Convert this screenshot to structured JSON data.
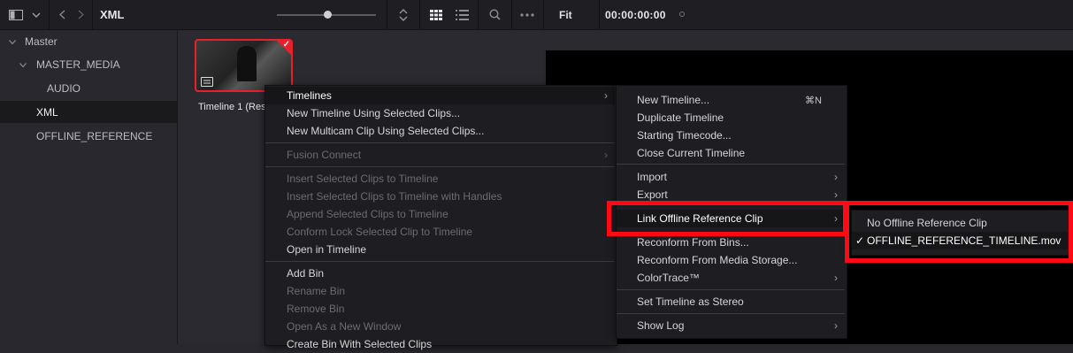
{
  "toolbar": {
    "path_title": "XML",
    "fit_label": "Fit",
    "timecode": "00:00:00:00"
  },
  "sidebar": {
    "items": [
      {
        "label": "Master",
        "expanded": true
      },
      {
        "label": "MASTER_MEDIA",
        "expanded": true
      },
      {
        "label": "AUDIO"
      },
      {
        "label": "XML",
        "selected": true
      },
      {
        "label": "OFFLINE_REFERENCE"
      }
    ]
  },
  "pool": {
    "clip_name": "Timeline 1 (Res"
  },
  "context_menu": {
    "items": [
      {
        "label": "Timelines",
        "state": "highlighted",
        "submenu": true
      },
      {
        "label": "New Timeline Using Selected Clips...",
        "state": "enabled"
      },
      {
        "label": "New Multicam Clip Using Selected Clips...",
        "state": "enabled"
      },
      {
        "label": "Fusion Connect",
        "state": "disabled",
        "submenu": true
      },
      {
        "label": "Insert Selected Clips to Timeline",
        "state": "disabled"
      },
      {
        "label": "Insert Selected Clips to Timeline with Handles",
        "state": "disabled"
      },
      {
        "label": "Append Selected Clips to Timeline",
        "state": "disabled"
      },
      {
        "label": "Conform Lock Selected Clip to Timeline",
        "state": "disabled"
      },
      {
        "label": "Open in Timeline",
        "state": "enabled"
      },
      {
        "label": "Add Bin",
        "state": "enabled"
      },
      {
        "label": "Rename Bin",
        "state": "disabled"
      },
      {
        "label": "Remove Bin",
        "state": "disabled"
      },
      {
        "label": "Open As a New Window",
        "state": "disabled"
      },
      {
        "label": "Create Bin With Selected Clips",
        "state": "enabled"
      }
    ]
  },
  "timelines_submenu": {
    "items": [
      {
        "label": "New Timeline...",
        "shortcut": "⌘N"
      },
      {
        "label": "Duplicate Timeline"
      },
      {
        "label": "Starting Timecode..."
      },
      {
        "label": "Close Current Timeline"
      },
      {
        "label": "Import",
        "submenu": true
      },
      {
        "label": "Export",
        "submenu": true
      },
      {
        "label": "Link Offline Reference Clip",
        "submenu": true,
        "state": "highlighted"
      },
      {
        "label": "Reconform From Bins..."
      },
      {
        "label": "Reconform From Media Storage..."
      },
      {
        "label": "ColorTrace™",
        "submenu": true
      },
      {
        "label": "Set Timeline as Stereo"
      },
      {
        "label": "Show Log",
        "submenu": true
      }
    ]
  },
  "offline_submenu": {
    "items": [
      {
        "label": "No Offline Reference Clip",
        "checked": false
      },
      {
        "label": "OFFLINE_REFERENCE_TIMELINE.mov",
        "checked": true,
        "check_glyph": "✓"
      }
    ]
  },
  "colors": {
    "annotation_red": "#ff0a14",
    "selection_red": "#e8202a",
    "menu_bg": "#1e1e22"
  }
}
